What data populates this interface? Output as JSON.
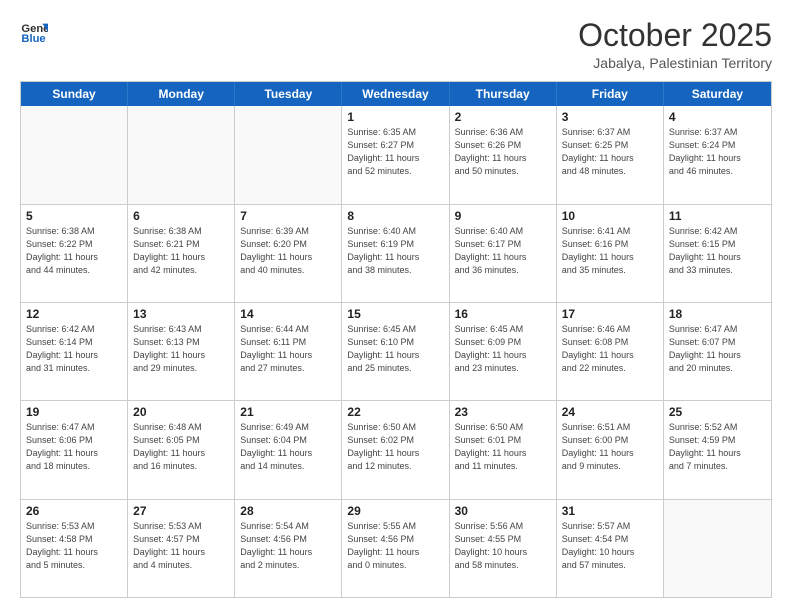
{
  "header": {
    "logo_line1": "General",
    "logo_line2": "Blue",
    "month": "October 2025",
    "location": "Jabalya, Palestinian Territory"
  },
  "weekdays": [
    "Sunday",
    "Monday",
    "Tuesday",
    "Wednesday",
    "Thursday",
    "Friday",
    "Saturday"
  ],
  "rows": [
    [
      {
        "day": "",
        "info": ""
      },
      {
        "day": "",
        "info": ""
      },
      {
        "day": "",
        "info": ""
      },
      {
        "day": "1",
        "info": "Sunrise: 6:35 AM\nSunset: 6:27 PM\nDaylight: 11 hours\nand 52 minutes."
      },
      {
        "day": "2",
        "info": "Sunrise: 6:36 AM\nSunset: 6:26 PM\nDaylight: 11 hours\nand 50 minutes."
      },
      {
        "day": "3",
        "info": "Sunrise: 6:37 AM\nSunset: 6:25 PM\nDaylight: 11 hours\nand 48 minutes."
      },
      {
        "day": "4",
        "info": "Sunrise: 6:37 AM\nSunset: 6:24 PM\nDaylight: 11 hours\nand 46 minutes."
      }
    ],
    [
      {
        "day": "5",
        "info": "Sunrise: 6:38 AM\nSunset: 6:22 PM\nDaylight: 11 hours\nand 44 minutes."
      },
      {
        "day": "6",
        "info": "Sunrise: 6:38 AM\nSunset: 6:21 PM\nDaylight: 11 hours\nand 42 minutes."
      },
      {
        "day": "7",
        "info": "Sunrise: 6:39 AM\nSunset: 6:20 PM\nDaylight: 11 hours\nand 40 minutes."
      },
      {
        "day": "8",
        "info": "Sunrise: 6:40 AM\nSunset: 6:19 PM\nDaylight: 11 hours\nand 38 minutes."
      },
      {
        "day": "9",
        "info": "Sunrise: 6:40 AM\nSunset: 6:17 PM\nDaylight: 11 hours\nand 36 minutes."
      },
      {
        "day": "10",
        "info": "Sunrise: 6:41 AM\nSunset: 6:16 PM\nDaylight: 11 hours\nand 35 minutes."
      },
      {
        "day": "11",
        "info": "Sunrise: 6:42 AM\nSunset: 6:15 PM\nDaylight: 11 hours\nand 33 minutes."
      }
    ],
    [
      {
        "day": "12",
        "info": "Sunrise: 6:42 AM\nSunset: 6:14 PM\nDaylight: 11 hours\nand 31 minutes."
      },
      {
        "day": "13",
        "info": "Sunrise: 6:43 AM\nSunset: 6:13 PM\nDaylight: 11 hours\nand 29 minutes."
      },
      {
        "day": "14",
        "info": "Sunrise: 6:44 AM\nSunset: 6:11 PM\nDaylight: 11 hours\nand 27 minutes."
      },
      {
        "day": "15",
        "info": "Sunrise: 6:45 AM\nSunset: 6:10 PM\nDaylight: 11 hours\nand 25 minutes."
      },
      {
        "day": "16",
        "info": "Sunrise: 6:45 AM\nSunset: 6:09 PM\nDaylight: 11 hours\nand 23 minutes."
      },
      {
        "day": "17",
        "info": "Sunrise: 6:46 AM\nSunset: 6:08 PM\nDaylight: 11 hours\nand 22 minutes."
      },
      {
        "day": "18",
        "info": "Sunrise: 6:47 AM\nSunset: 6:07 PM\nDaylight: 11 hours\nand 20 minutes."
      }
    ],
    [
      {
        "day": "19",
        "info": "Sunrise: 6:47 AM\nSunset: 6:06 PM\nDaylight: 11 hours\nand 18 minutes."
      },
      {
        "day": "20",
        "info": "Sunrise: 6:48 AM\nSunset: 6:05 PM\nDaylight: 11 hours\nand 16 minutes."
      },
      {
        "day": "21",
        "info": "Sunrise: 6:49 AM\nSunset: 6:04 PM\nDaylight: 11 hours\nand 14 minutes."
      },
      {
        "day": "22",
        "info": "Sunrise: 6:50 AM\nSunset: 6:02 PM\nDaylight: 11 hours\nand 12 minutes."
      },
      {
        "day": "23",
        "info": "Sunrise: 6:50 AM\nSunset: 6:01 PM\nDaylight: 11 hours\nand 11 minutes."
      },
      {
        "day": "24",
        "info": "Sunrise: 6:51 AM\nSunset: 6:00 PM\nDaylight: 11 hours\nand 9 minutes."
      },
      {
        "day": "25",
        "info": "Sunrise: 5:52 AM\nSunset: 4:59 PM\nDaylight: 11 hours\nand 7 minutes."
      }
    ],
    [
      {
        "day": "26",
        "info": "Sunrise: 5:53 AM\nSunset: 4:58 PM\nDaylight: 11 hours\nand 5 minutes."
      },
      {
        "day": "27",
        "info": "Sunrise: 5:53 AM\nSunset: 4:57 PM\nDaylight: 11 hours\nand 4 minutes."
      },
      {
        "day": "28",
        "info": "Sunrise: 5:54 AM\nSunset: 4:56 PM\nDaylight: 11 hours\nand 2 minutes."
      },
      {
        "day": "29",
        "info": "Sunrise: 5:55 AM\nSunset: 4:56 PM\nDaylight: 11 hours\nand 0 minutes."
      },
      {
        "day": "30",
        "info": "Sunrise: 5:56 AM\nSunset: 4:55 PM\nDaylight: 10 hours\nand 58 minutes."
      },
      {
        "day": "31",
        "info": "Sunrise: 5:57 AM\nSunset: 4:54 PM\nDaylight: 10 hours\nand 57 minutes."
      },
      {
        "day": "",
        "info": ""
      }
    ]
  ]
}
